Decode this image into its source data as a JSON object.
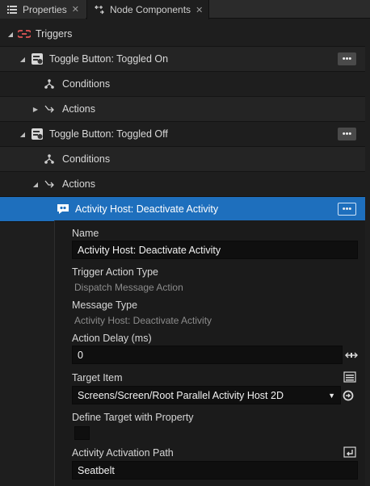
{
  "tabs": [
    {
      "label": "Properties",
      "close": "✕"
    },
    {
      "label": "Node Components",
      "close": "✕"
    }
  ],
  "tree": {
    "root": {
      "label": "Triggers"
    },
    "trigger1": {
      "label": "Toggle Button: Toggled On",
      "more": "•••"
    },
    "trigger1_conditions": {
      "label": "Conditions"
    },
    "trigger1_actions": {
      "label": "Actions"
    },
    "trigger2": {
      "label": "Toggle Button: Toggled Off",
      "more": "•••"
    },
    "trigger2_conditions": {
      "label": "Conditions"
    },
    "trigger2_actions": {
      "label": "Actions"
    },
    "action": {
      "label": "Activity Host: Deactivate Activity",
      "more": "•••"
    }
  },
  "panel": {
    "name": {
      "label": "Name",
      "value": "Activity Host: Deactivate Activity"
    },
    "trigger_action_type": {
      "label": "Trigger Action Type",
      "value": "Dispatch Message Action"
    },
    "message_type": {
      "label": "Message Type",
      "value": "Activity Host: Deactivate Activity"
    },
    "action_delay": {
      "label": "Action Delay (ms)",
      "value": "0"
    },
    "target_item": {
      "label": "Target Item",
      "value": "Screens/Screen/Root Parallel Activity Host 2D"
    },
    "define_target": {
      "label": "Define Target with Property",
      "checked": false
    },
    "activation_path": {
      "label": "Activity Activation Path",
      "value": "Seatbelt"
    }
  },
  "colors": {
    "accent": "#1e6fbd",
    "trigger_icon": "#e05555",
    "background": "#1e1e1e"
  }
}
